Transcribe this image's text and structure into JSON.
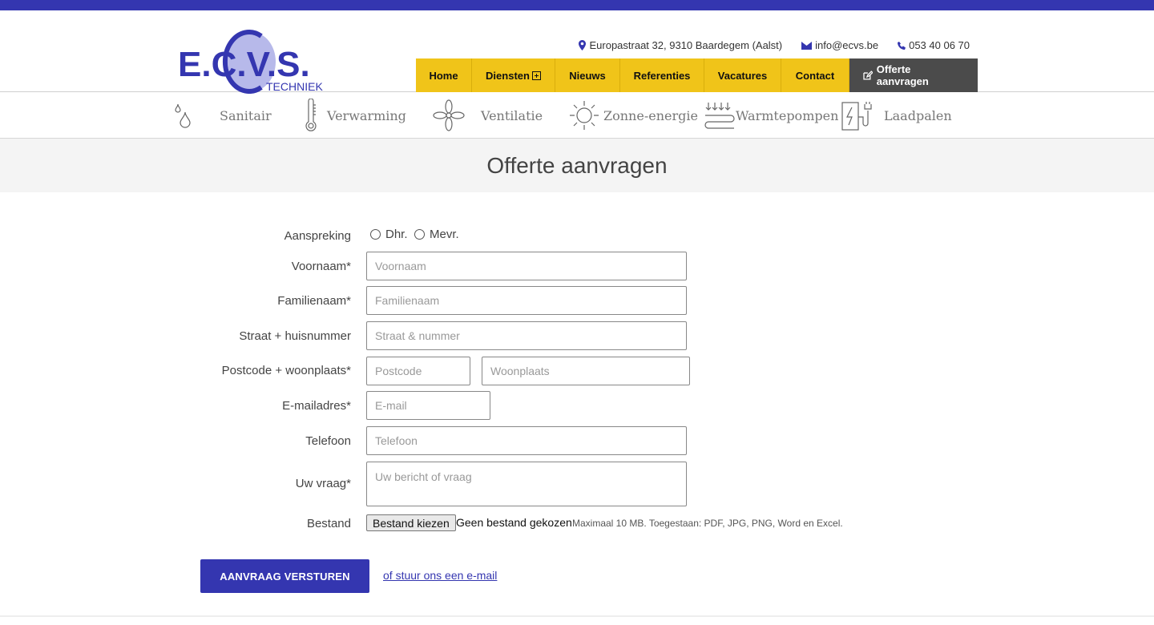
{
  "header": {
    "logo": {
      "text_main": "E.C.V.S.",
      "text_sub": "TECHNIEK",
      "color": "#3436b0",
      "accent": "#b7b9ea"
    },
    "address": "Europastraat 32, 9310 Baardegem (Aalst)",
    "email": "info@ecvs.be",
    "phone": "053 40 06 70"
  },
  "nav": {
    "items": [
      {
        "label": "Home"
      },
      {
        "label": "Diensten"
      },
      {
        "label": "Nieuws"
      },
      {
        "label": "Referenties"
      },
      {
        "label": "Vacatures"
      },
      {
        "label": "Contact"
      }
    ],
    "cta": "Offerte aanvragen"
  },
  "services": [
    {
      "label": "Sanitair",
      "icon": "water-drop-icon"
    },
    {
      "label": "Verwarming",
      "icon": "thermometer-icon"
    },
    {
      "label": "Ventilatie",
      "icon": "fan-icon"
    },
    {
      "label": "Zonne-energie",
      "icon": "sun-icon"
    },
    {
      "label": "Warmtepompen",
      "icon": "heat-pump-icon"
    },
    {
      "label": "Laadpalen",
      "icon": "charging-station-icon"
    }
  ],
  "page": {
    "title": "Offerte aanvragen"
  },
  "form": {
    "aanspreking": {
      "label": "Aanspreking",
      "options": [
        "Dhr.",
        "Mevr."
      ]
    },
    "voornaam": {
      "label": "Voornaam*",
      "placeholder": "Voornaam"
    },
    "familienaam": {
      "label": "Familienaam*",
      "placeholder": "Familienaam"
    },
    "straat": {
      "label": "Straat + huisnummer",
      "placeholder": "Straat & nummer"
    },
    "postcode": {
      "label": "Postcode + woonplaats*",
      "placeholder_postcode": "Postcode",
      "placeholder_woonplaats": "Woonplaats"
    },
    "email": {
      "label": "E-mailadres*",
      "placeholder": "E-mail"
    },
    "telefoon": {
      "label": "Telefoon",
      "placeholder": "Telefoon"
    },
    "vraag": {
      "label": "Uw vraag*",
      "placeholder": "Uw bericht of vraag"
    },
    "bestand": {
      "label": "Bestand",
      "button": "Bestand kiezen",
      "status": "Geen bestand gekozen",
      "hint": "Maximaal 10 MB. Toegestaan: PDF, JPG, PNG, Word en Excel."
    },
    "submit": "AANVRAAG VERSTUREN",
    "mail_link": "of stuur ons een e-mail"
  }
}
